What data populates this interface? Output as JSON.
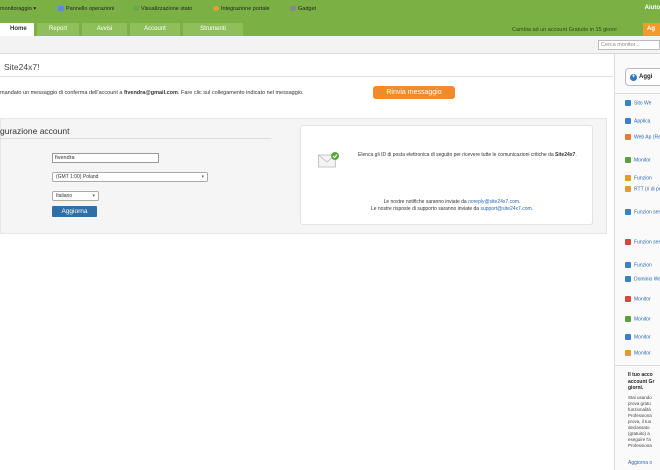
{
  "header": {
    "account_label": "Aiuto",
    "tabs": [
      {
        "label": "Home"
      },
      {
        "label": "Report"
      },
      {
        "label": "Avvisi"
      },
      {
        "label": "Account"
      },
      {
        "label": "Strumenti"
      }
    ],
    "trial_text": "Cambia ad un account Gratuito in 15 giorni",
    "upgrade_label": "Ag"
  },
  "toolbar": {
    "items": [
      {
        "label": "monitoraggio ▾"
      },
      {
        "label": "Pannello operazioni"
      },
      {
        "label": "Visualizzazione stato"
      },
      {
        "label": "Integrazione portale"
      },
      {
        "label": "Gadget"
      }
    ],
    "search_placeholder": "Cerca monitor..."
  },
  "page": {
    "title": "Site24x7!",
    "notice_prefix": "mandato un messaggio di conferma dell'account a ",
    "notice_email": "fivendra@gmail.com",
    "notice_suffix": ". Fare clic sul collegamento indicato nel messaggio.",
    "resend_label": "Rinvia messaggio"
  },
  "config": {
    "title": "gurazione account",
    "name_value": "fivendra",
    "timezone_value": "(GMT 1:00) Poland",
    "language_value": "Italiano",
    "save_label": "Aggiorna"
  },
  "info": {
    "line1_prefix": "Elenca gli ID di posta elettronica di seguito per ricevere tutte le comunicazioni critiche da ",
    "line1_brand": "Site24x7",
    "line1_end": ".",
    "line2_prefix": "Le nostre notifiche saranno inviate da ",
    "line2_link": "noreply@site24x7.com",
    "line2_end": ".",
    "line3_prefix": "Le nostre risposte di supporto saranno inviate da ",
    "line3_link": "support@site24x7.com",
    "line3_end": "."
  },
  "sidebar": {
    "add_label": "Aggi",
    "items": [
      {
        "label": "Sito We",
        "color": "#3b7fc4"
      },
      {
        "label": "Applica",
        "color": "#3b7fc4"
      },
      {
        "label": "Web Ap (Real B",
        "color": "#e07b39"
      },
      {
        "label": "Monitor",
        "color": "#5aa03c"
      },
      {
        "label": "Funzion",
        "color": "#e09b2d"
      },
      {
        "label": "RTT (ri di posta",
        "color": "#e09b2d"
      },
      {
        "label": "Funzion servizio",
        "color": "#3b7fc4"
      },
      {
        "label": "Funzion servizio",
        "color": "#d04a3a"
      },
      {
        "label": "Funzion",
        "color": "#3b7fc4"
      },
      {
        "label": "Dominio Web",
        "color": "#3b7fc4"
      },
      {
        "label": "Monitor",
        "color": "#d04a3a"
      },
      {
        "label": "Monitor",
        "color": "#5aa03c"
      },
      {
        "label": "Monitor",
        "color": "#3b7fc4"
      },
      {
        "label": "Monitor",
        "color": "#e09b2d"
      }
    ],
    "promo_title": "Il tuo acco account Gr giorni.",
    "promo_text": "Stai usando prova gratu funzionalità Professiona prova, il tuo declassato (gratuito) a eseguire l'a Professiona",
    "promo_link": "Aggiorna o"
  }
}
